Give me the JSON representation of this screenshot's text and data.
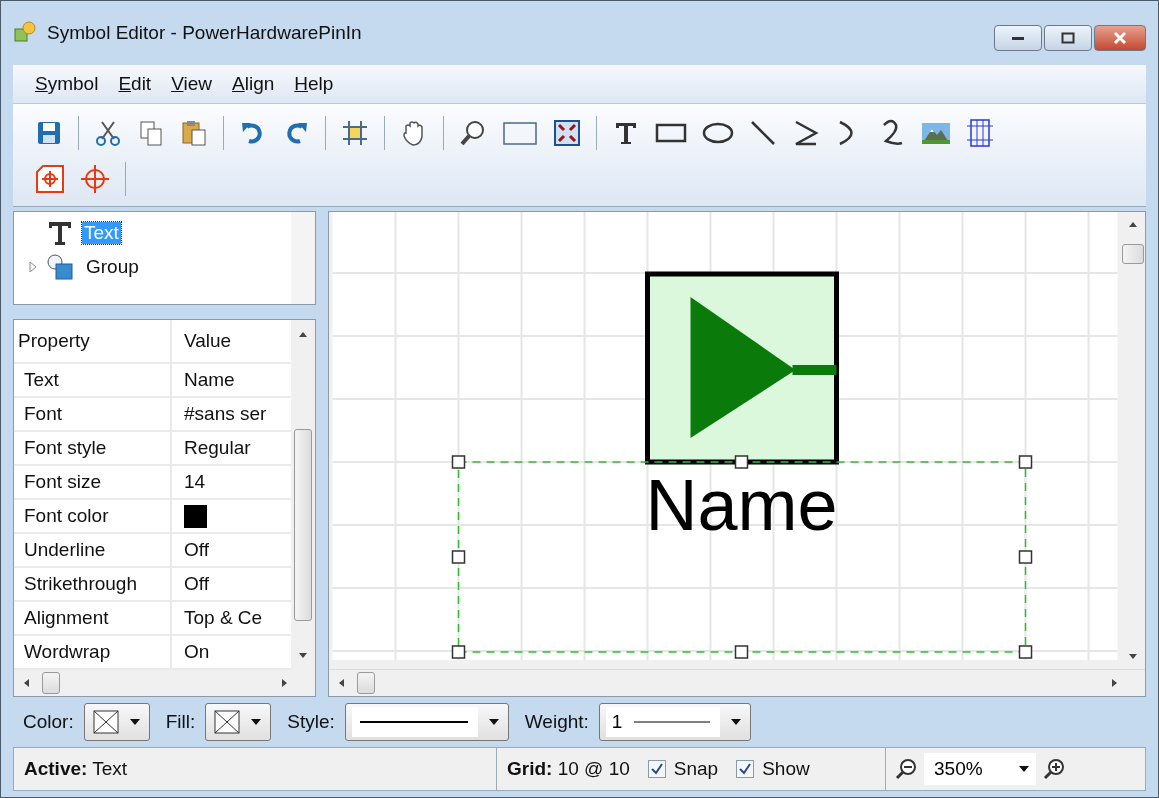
{
  "window": {
    "title": "Symbol Editor - PowerHardwarePinIn"
  },
  "menu": [
    {
      "label": "Symbol"
    },
    {
      "label": "Edit"
    },
    {
      "label": "View"
    },
    {
      "label": "Align"
    },
    {
      "label": "Help"
    }
  ],
  "tree": [
    {
      "label": "Text",
      "kind": "text",
      "selected": true
    },
    {
      "label": "Group",
      "kind": "group",
      "selected": false,
      "expanded": false
    }
  ],
  "properties": {
    "columns": [
      "Property",
      "Value"
    ],
    "rows": [
      {
        "name": "Text",
        "value": "Name"
      },
      {
        "name": "Font",
        "value": "#sans ser"
      },
      {
        "name": "Font style",
        "value": "Regular"
      },
      {
        "name": "Font size",
        "value": "14"
      },
      {
        "name": "Font color",
        "kind": "swatch",
        "color": "#000000"
      },
      {
        "name": "Underline",
        "value": "Off"
      },
      {
        "name": "Strikethrough",
        "value": "Off"
      },
      {
        "name": "Alignment",
        "value": "Top & Ce"
      },
      {
        "name": "Wordwrap",
        "value": "On"
      }
    ]
  },
  "canvas": {
    "label": "Name"
  },
  "bottom_toolbar": {
    "color_label": "Color:",
    "fill_label": "Fill:",
    "style_label": "Style:",
    "weight_label": "Weight:",
    "weight_value": "1"
  },
  "status_bar": {
    "active_label": "Active:",
    "active_value": "Text",
    "grid_label": "Grid:",
    "grid_value": "10 @ 10",
    "checks": [
      {
        "label": "Snap",
        "checked": true
      },
      {
        "label": "Show",
        "checked": true
      }
    ],
    "zoom": "350%"
  }
}
